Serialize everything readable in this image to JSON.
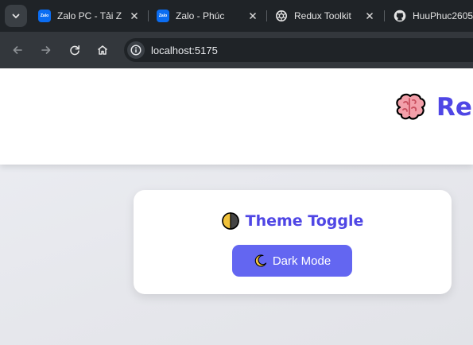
{
  "browser": {
    "tabs": [
      {
        "title": "Zalo PC - Tải Z",
        "favicon": "zalo-icon"
      },
      {
        "title": "Zalo - Phúc",
        "favicon": "zalo-icon"
      },
      {
        "title": "Redux Toolkit",
        "favicon": "openai-icon"
      },
      {
        "title": "HuuPhuc2605",
        "favicon": "github-icon"
      }
    ],
    "favicon_label": "Zalo",
    "address": "localhost:5175"
  },
  "app": {
    "brand_emoji": "brain-icon",
    "brand_text": "Re",
    "card": {
      "title": "Theme Toggle",
      "title_icon": "half-moon-icon",
      "button_label": "Dark Mode",
      "button_icon": "crescent-moon-icon"
    }
  },
  "colors": {
    "accent": "#4f46e5",
    "button": "#6366f1",
    "tab_strip": "#1f2327",
    "toolbar": "#33373c"
  }
}
